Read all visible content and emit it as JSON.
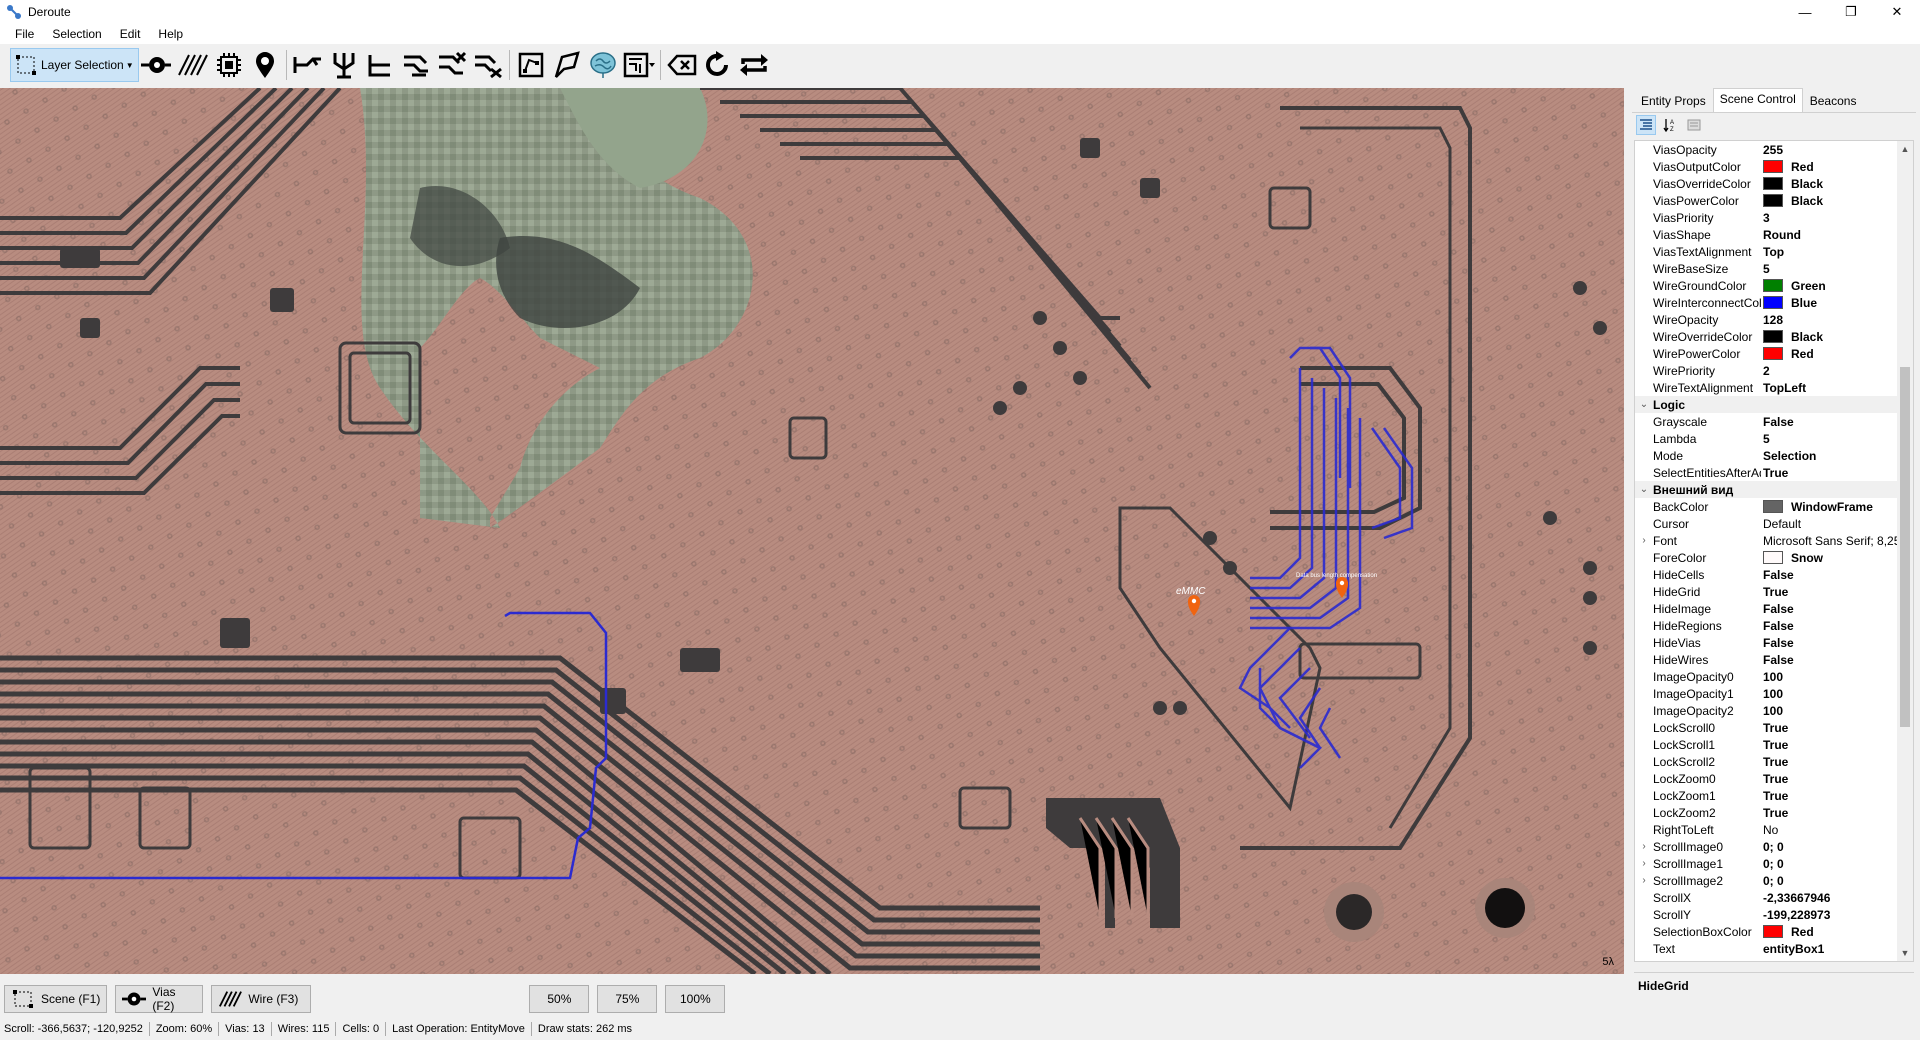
{
  "app": {
    "title": "Deroute"
  },
  "window_controls": {
    "minimize": "—",
    "maximize": "❐",
    "close": "✕"
  },
  "menu": [
    "File",
    "Selection",
    "Edit",
    "Help"
  ],
  "toolbar": {
    "layer_selection_label": "Layer Selection",
    "tools": [
      "via-tool-icon",
      "wire-tool-icon",
      "cell-tool-icon",
      "beacon-icon",
      "route-single-icon",
      "route-tree-icon",
      "route-multi-icon",
      "route-combine-icon",
      "route-delete-icon",
      "region-icon",
      "polygon-icon",
      "neural-icon",
      "chip-map-icon",
      "eraser-icon",
      "rotate-icon",
      "swap-icon"
    ]
  },
  "canvas": {
    "annotation_emmc": "eMMC",
    "annotation_bus": "Data bus length compensation",
    "corner_badge": "5λ"
  },
  "right_panel": {
    "tabs": [
      "Entity Props",
      "Scene Control",
      "Beacons"
    ],
    "active_tab": "Scene Control",
    "rows": [
      {
        "type": "prop",
        "name": "ViasOpacity",
        "value": "255"
      },
      {
        "type": "prop",
        "name": "ViasOutputColor",
        "value": "Red",
        "swatch": "#ff0000"
      },
      {
        "type": "prop",
        "name": "ViasOverrideColor",
        "value": "Black",
        "swatch": "#000000"
      },
      {
        "type": "prop",
        "name": "ViasPowerColor",
        "value": "Black",
        "swatch": "#000000"
      },
      {
        "type": "prop",
        "name": "ViasPriority",
        "value": "3"
      },
      {
        "type": "prop",
        "name": "ViasShape",
        "value": "Round"
      },
      {
        "type": "prop",
        "name": "ViasTextAlignment",
        "value": "Top"
      },
      {
        "type": "prop",
        "name": "WireBaseSize",
        "value": "5"
      },
      {
        "type": "prop",
        "name": "WireGroundColor",
        "value": "Green",
        "swatch": "#008000"
      },
      {
        "type": "prop",
        "name": "WireInterconnectColor",
        "value": "Blue",
        "swatch": "#0000ff"
      },
      {
        "type": "prop",
        "name": "WireOpacity",
        "value": "128"
      },
      {
        "type": "prop",
        "name": "WireOverrideColor",
        "value": "Black",
        "swatch": "#000000"
      },
      {
        "type": "prop",
        "name": "WirePowerColor",
        "value": "Red",
        "swatch": "#ff0000"
      },
      {
        "type": "prop",
        "name": "WirePriority",
        "value": "2"
      },
      {
        "type": "prop",
        "name": "WireTextAlignment",
        "value": "TopLeft"
      },
      {
        "type": "cat",
        "name": "Logic"
      },
      {
        "type": "prop",
        "name": "Grayscale",
        "value": "False"
      },
      {
        "type": "prop",
        "name": "Lambda",
        "value": "5"
      },
      {
        "type": "prop",
        "name": "Mode",
        "value": "Selection"
      },
      {
        "type": "prop",
        "name": "SelectEntitiesAfterAdd",
        "value": "True"
      },
      {
        "type": "cat",
        "name": "Внешний вид"
      },
      {
        "type": "prop",
        "name": "BackColor",
        "value": "WindowFrame",
        "swatch": "#646464"
      },
      {
        "type": "prop",
        "name": "Cursor",
        "value": "Default",
        "normal": true
      },
      {
        "type": "prop",
        "name": "Font",
        "value": "Microsoft Sans Serif; 8,25pt",
        "normal": true,
        "expandable": true
      },
      {
        "type": "prop",
        "name": "ForeColor",
        "value": "Snow",
        "swatch": "#fffafa"
      },
      {
        "type": "prop",
        "name": "HideCells",
        "value": "False"
      },
      {
        "type": "prop",
        "name": "HideGrid",
        "value": "True"
      },
      {
        "type": "prop",
        "name": "HideImage",
        "value": "False"
      },
      {
        "type": "prop",
        "name": "HideRegions",
        "value": "False"
      },
      {
        "type": "prop",
        "name": "HideVias",
        "value": "False"
      },
      {
        "type": "prop",
        "name": "HideWires",
        "value": "False"
      },
      {
        "type": "prop",
        "name": "ImageOpacity0",
        "value": "100"
      },
      {
        "type": "prop",
        "name": "ImageOpacity1",
        "value": "100"
      },
      {
        "type": "prop",
        "name": "ImageOpacity2",
        "value": "100"
      },
      {
        "type": "prop",
        "name": "LockScroll0",
        "value": "True"
      },
      {
        "type": "prop",
        "name": "LockScroll1",
        "value": "True"
      },
      {
        "type": "prop",
        "name": "LockScroll2",
        "value": "True"
      },
      {
        "type": "prop",
        "name": "LockZoom0",
        "value": "True"
      },
      {
        "type": "prop",
        "name": "LockZoom1",
        "value": "True"
      },
      {
        "type": "prop",
        "name": "LockZoom2",
        "value": "True"
      },
      {
        "type": "prop",
        "name": "RightToLeft",
        "value": "No",
        "normal": true
      },
      {
        "type": "prop",
        "name": "ScrollImage0",
        "value": "0; 0",
        "expandable": true
      },
      {
        "type": "prop",
        "name": "ScrollImage1",
        "value": "0; 0",
        "expandable": true
      },
      {
        "type": "prop",
        "name": "ScrollImage2",
        "value": "0; 0",
        "expandable": true
      },
      {
        "type": "prop",
        "name": "ScrollX",
        "value": "-2,33667946"
      },
      {
        "type": "prop",
        "name": "ScrollY",
        "value": "-199,228973"
      },
      {
        "type": "prop",
        "name": "SelectionBoxColor",
        "value": "Red",
        "swatch": "#ff0000"
      },
      {
        "type": "prop",
        "name": "Text",
        "value": "entityBox1"
      },
      {
        "type": "prop",
        "name": "UseWaitCursor",
        "value": "False"
      }
    ],
    "description_title": "HideGrid"
  },
  "bottom_bar": {
    "scene_label": "Scene (F1)",
    "vias_label": "Vias (F2)",
    "wire_label": "Wire (F3)",
    "zoom_buttons": [
      "50%",
      "75%",
      "100%"
    ]
  },
  "status": {
    "scroll_label": "Scroll:",
    "scroll_value": "-366,5637; -120,9252",
    "zoom_label": "Zoom:",
    "zoom_value": "60%",
    "vias_label": "Vias:",
    "vias_value": "13",
    "wires_label": "Wires:",
    "wires_value": "115",
    "cells_label": "Cells:",
    "cells_value": "0",
    "lastop_label": "Last Operation:",
    "lastop_value": "EntityMove",
    "drawstats_label": "Draw stats:",
    "drawstats_value": "262 ms"
  },
  "colors": {
    "copper": "#b58a7e",
    "trace": "#3e3b3c",
    "wire": "#2b2bd0",
    "fiberglass": "#8fa08a",
    "accent_select": "#cce4f7"
  }
}
